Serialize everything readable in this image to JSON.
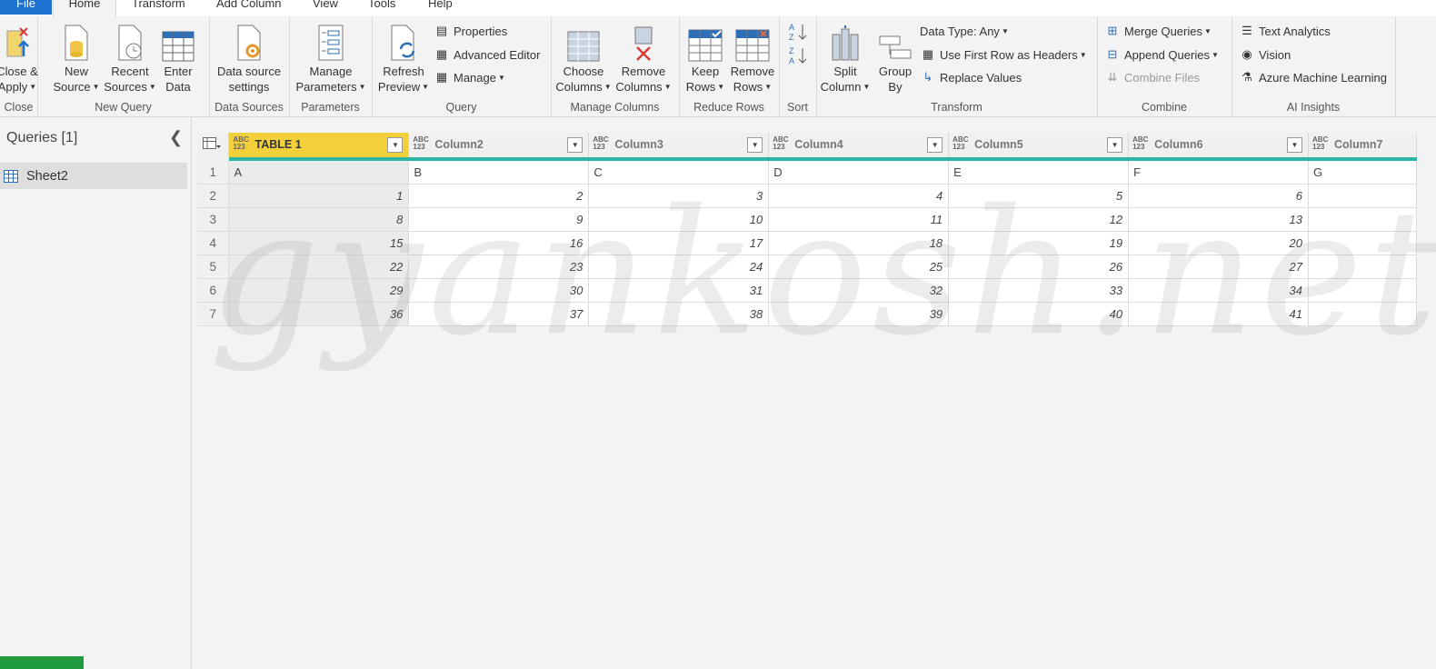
{
  "tabs": [
    "File",
    "Home",
    "Transform",
    "Add Column",
    "View",
    "Tools",
    "Help"
  ],
  "ribbon": {
    "close": {
      "label": "Close",
      "close_apply": [
        "Close &",
        "Apply"
      ]
    },
    "new_query": {
      "label": "New Query",
      "new_source": [
        "New",
        "Source"
      ],
      "recent_sources": [
        "Recent",
        "Sources"
      ],
      "enter_data": [
        "Enter",
        "Data"
      ]
    },
    "data_sources": {
      "label": "Data Sources",
      "settings": [
        "Data source",
        "settings"
      ]
    },
    "parameters": {
      "label": "Parameters",
      "manage": [
        "Manage",
        "Parameters"
      ]
    },
    "query": {
      "label": "Query",
      "refresh": [
        "Refresh",
        "Preview"
      ],
      "properties": "Properties",
      "advanced_editor": "Advanced Editor",
      "manage": "Manage"
    },
    "manage_columns": {
      "label": "Manage Columns",
      "choose": [
        "Choose",
        "Columns"
      ],
      "remove": [
        "Remove",
        "Columns"
      ]
    },
    "reduce_rows": {
      "label": "Reduce Rows",
      "keep": [
        "Keep",
        "Rows"
      ],
      "remove": [
        "Remove",
        "Rows"
      ]
    },
    "sort": {
      "label": "Sort"
    },
    "transform": {
      "label": "Transform",
      "split": [
        "Split",
        "Column"
      ],
      "group": [
        "Group",
        "By"
      ],
      "data_type": "Data Type: Any",
      "first_row": "Use First Row as Headers",
      "replace": "Replace Values"
    },
    "combine": {
      "label": "Combine",
      "merge": "Merge Queries",
      "append": "Append Queries",
      "combine_files": "Combine Files"
    },
    "ai": {
      "label": "AI Insights",
      "text_analytics": "Text Analytics",
      "vision": "Vision",
      "azure_ml": "Azure Machine Learning"
    }
  },
  "queries": {
    "title": "Queries [1]",
    "items": [
      "Sheet2"
    ]
  },
  "grid": {
    "type_badge": [
      "ABC",
      "123"
    ],
    "columns": [
      "TABLE 1",
      "Column2",
      "Column3",
      "Column4",
      "Column5",
      "Column6",
      "Column7"
    ],
    "rows": [
      [
        "1",
        "A",
        "B",
        "C",
        "D",
        "E",
        "F",
        "G"
      ],
      [
        "2",
        "1",
        "2",
        "3",
        "4",
        "5",
        "6",
        ""
      ],
      [
        "3",
        "8",
        "9",
        "10",
        "11",
        "12",
        "13",
        ""
      ],
      [
        "4",
        "15",
        "16",
        "17",
        "18",
        "19",
        "20",
        ""
      ],
      [
        "5",
        "22",
        "23",
        "24",
        "25",
        "26",
        "27",
        ""
      ],
      [
        "6",
        "29",
        "30",
        "31",
        "32",
        "33",
        "34",
        ""
      ],
      [
        "7",
        "36",
        "37",
        "38",
        "39",
        "40",
        "41",
        ""
      ]
    ]
  },
  "watermark": "gyankosh.net",
  "colors": {
    "accent_blue": "#1e73d1",
    "selected_header": "#f4cf3c",
    "quality_bar": "#2bb5a5",
    "status_green": "#1f9a3f"
  }
}
